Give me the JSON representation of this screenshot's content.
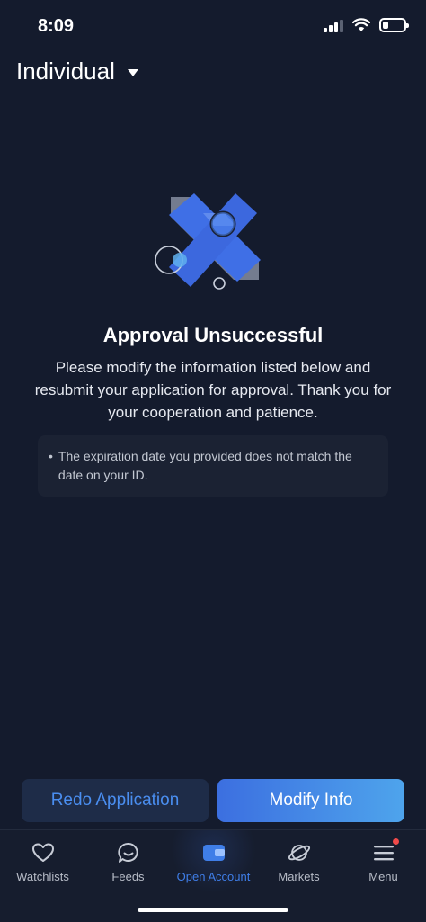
{
  "status_bar": {
    "time": "8:09",
    "icons": [
      "signal-icon",
      "wifi-icon",
      "battery-icon"
    ]
  },
  "header": {
    "account_type": "Individual",
    "dropdown_icon": "caret-down-icon"
  },
  "result": {
    "illustration_icon": "failed-x-illustration",
    "title": "Approval Unsuccessful",
    "message": "Please modify the information listed below and resubmit your application for approval. Thank you for your cooperation and patience.",
    "reasons": [
      "The expiration date you provided does not match the date on your ID."
    ],
    "bullet": "•"
  },
  "actions": {
    "redo_label": "Redo Application",
    "modify_label": "Modify Info"
  },
  "tab_bar": {
    "tabs": [
      {
        "label": "Watchlists",
        "icon": "heart-icon"
      },
      {
        "label": "Feeds",
        "icon": "chat-bubble-icon"
      },
      {
        "label": "Open Account",
        "icon": "wallet-icon",
        "active": true
      },
      {
        "label": "Markets",
        "icon": "planet-icon"
      },
      {
        "label": "Menu",
        "icon": "hamburger-menu-icon",
        "badge": true
      }
    ]
  },
  "colors": {
    "background": "#141b2d",
    "accent": "#3f7ee8",
    "badge": "#f04a4a"
  }
}
